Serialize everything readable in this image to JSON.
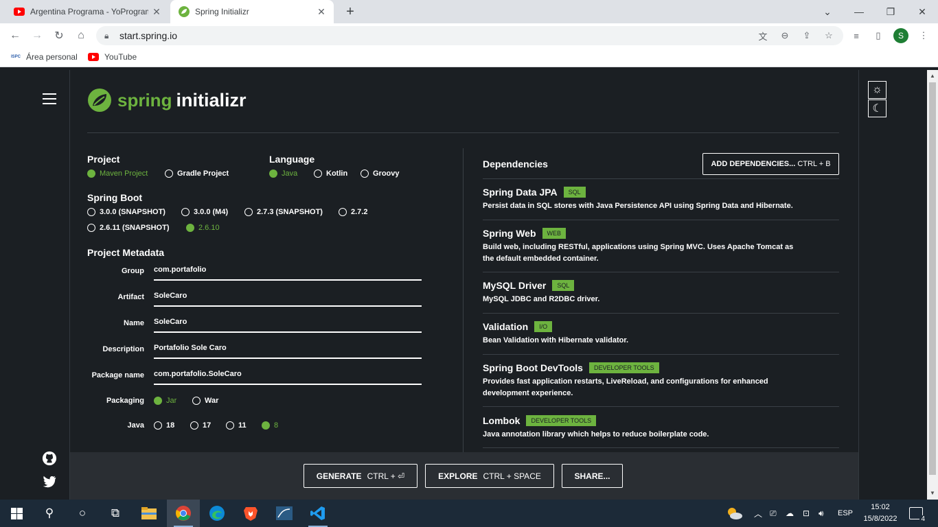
{
  "browser": {
    "tabs": [
      {
        "title": "Argentina Programa - YoProgram",
        "active": false
      },
      {
        "title": "Spring Initializr",
        "active": true
      }
    ],
    "url": "start.spring.io",
    "profile_initial": "S",
    "bookmarks": [
      {
        "label": "Área personal",
        "icon_text": "ISPC"
      },
      {
        "label": "YouTube"
      }
    ]
  },
  "app": {
    "brand_spring": "spring",
    "brand_initializr": "initializr"
  },
  "project": {
    "title": "Project",
    "options": [
      {
        "label": "Maven Project",
        "checked": true
      },
      {
        "label": "Gradle Project",
        "checked": false
      }
    ]
  },
  "language": {
    "title": "Language",
    "options": [
      {
        "label": "Java",
        "checked": true
      },
      {
        "label": "Kotlin",
        "checked": false
      },
      {
        "label": "Groovy",
        "checked": false
      }
    ]
  },
  "spring_boot": {
    "title": "Spring Boot",
    "options": [
      {
        "label": "3.0.0 (SNAPSHOT)",
        "checked": false
      },
      {
        "label": "3.0.0 (M4)",
        "checked": false
      },
      {
        "label": "2.7.3 (SNAPSHOT)",
        "checked": false
      },
      {
        "label": "2.7.2",
        "checked": false
      },
      {
        "label": "2.6.11 (SNAPSHOT)",
        "checked": false
      },
      {
        "label": "2.6.10",
        "checked": true
      }
    ]
  },
  "metadata": {
    "title": "Project Metadata",
    "fields": [
      {
        "label": "Group",
        "value": "com.portafolio"
      },
      {
        "label": "Artifact",
        "value": "SoleCaro"
      },
      {
        "label": "Name",
        "value": "SoleCaro"
      },
      {
        "label": "Description",
        "value": "Portafolio Sole Caro"
      },
      {
        "label": "Package name",
        "value": "com.portafolio.SoleCaro"
      }
    ],
    "packaging": {
      "label": "Packaging",
      "options": [
        {
          "label": "Jar",
          "checked": true
        },
        {
          "label": "War",
          "checked": false
        }
      ]
    },
    "java": {
      "label": "Java",
      "options": [
        {
          "label": "18",
          "checked": false
        },
        {
          "label": "17",
          "checked": false
        },
        {
          "label": "11",
          "checked": false
        },
        {
          "label": "8",
          "checked": true
        }
      ]
    }
  },
  "dependencies": {
    "title": "Dependencies",
    "add_label": "ADD DEPENDENCIES...",
    "add_shortcut": "CTRL + B",
    "items": [
      {
        "name": "Spring Data JPA",
        "tag": "SQL",
        "desc": "Persist data in SQL stores with Java Persistence API using Spring Data and Hibernate."
      },
      {
        "name": "Spring Web",
        "tag": "WEB",
        "desc": "Build web, including RESTful, applications using Spring MVC. Uses Apache Tomcat as the default embedded container."
      },
      {
        "name": "MySQL Driver",
        "tag": "SQL",
        "desc": "MySQL JDBC and R2DBC driver."
      },
      {
        "name": "Validation",
        "tag": "I/O",
        "desc": "Bean Validation with Hibernate validator."
      },
      {
        "name": "Spring Boot DevTools",
        "tag": "DEVELOPER TOOLS",
        "desc": "Provides fast application restarts, LiveReload, and configurations for enhanced development experience."
      },
      {
        "name": "Lombok",
        "tag": "DEVELOPER TOOLS",
        "desc": "Java annotation library which helps to reduce boilerplate code."
      }
    ]
  },
  "footer": {
    "generate": "GENERATE",
    "generate_key": "CTRL + ⏎",
    "explore": "EXPLORE",
    "explore_key": "CTRL + SPACE",
    "share": "SHARE..."
  },
  "taskbar": {
    "time": "15:02",
    "date": "15/8/2022",
    "language": "ESP",
    "notifications": "4"
  }
}
